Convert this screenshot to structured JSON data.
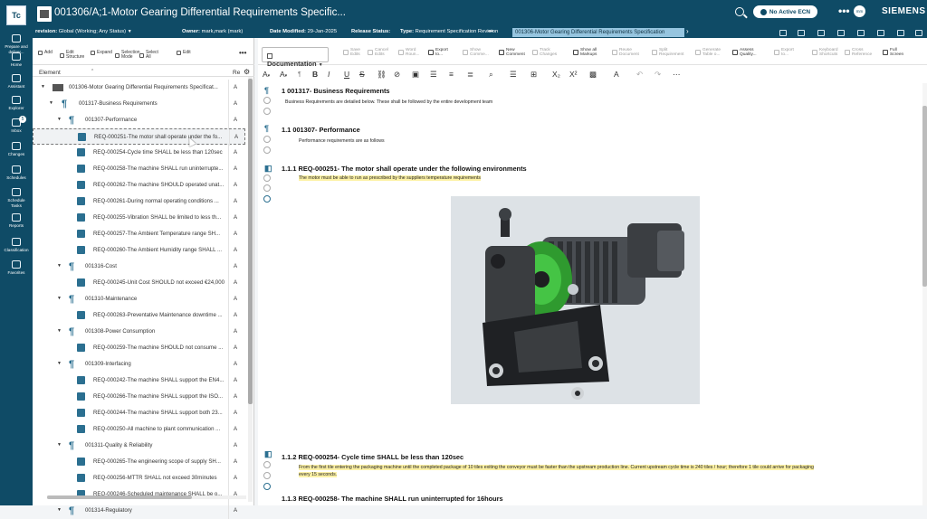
{
  "nav": {
    "logo": "Tc",
    "items": [
      {
        "label_1": "Prepare and",
        "label_2": "deliver..."
      },
      {
        "label_1": "Home",
        "label_2": ""
      },
      {
        "label_1": "Assistant",
        "label_2": ""
      },
      {
        "label_1": "Explorer",
        "label_2": ""
      },
      {
        "label_1": "Inbox",
        "label_2": ""
      },
      {
        "label_1": "Changes",
        "label_2": ""
      },
      {
        "label_1": "Schedules",
        "label_2": ""
      },
      {
        "label_1": "Schedule",
        "label_2": "Tasks"
      },
      {
        "label_1": "Reports",
        "label_2": ""
      },
      {
        "label_1": "Classification",
        "label_2": ""
      },
      {
        "label_1": "Favorites",
        "label_2": ""
      }
    ],
    "inbox_badge": "5"
  },
  "header": {
    "title": "001306/A;1-Motor Gearing Differential Requirements Specific...",
    "ecn": "No Active ECN",
    "avatar": "mm",
    "brand": "SIEMENS",
    "more": "•••"
  },
  "info": {
    "revision_label": "revision:",
    "revision_value": "Global (Working; Any Status)",
    "owner_label": "Owner:",
    "owner_value": "mark,mark (mark)",
    "date_label": "Date Modified:",
    "date_value": "29-Jan-2025",
    "release_label": "Release Status:",
    "type_label": "Type:",
    "type_value": "Requirement Specification Revision",
    "more": "•••",
    "tag": "001306-Motor Gearing Differential Requirements Specification",
    "chevron": "›"
  },
  "left_toolbar": [
    {
      "l1": "Add",
      "l2": ""
    },
    {
      "l1": "Edit",
      "l2": "Structure"
    },
    {
      "l1": "Expand",
      "l2": ""
    },
    {
      "l1": "Selection",
      "l2": "Mode"
    },
    {
      "l1": "Select",
      "l2": "All"
    },
    {
      "l1": "Edit",
      "l2": ""
    }
  ],
  "left_more": "•••",
  "tree_header": {
    "element": "Element",
    "rev": "Re"
  },
  "tree": [
    {
      "label": "001306-Motor Gearing Differential Requirements Specificat...",
      "rev": "A",
      "level": 0,
      "icon": "root",
      "toggle": "▼"
    },
    {
      "label": "001317-Business Requirements",
      "rev": "A",
      "level": 1,
      "icon": "para",
      "toggle": "▼"
    },
    {
      "label": "001307-Performance",
      "rev": "A",
      "level": 2,
      "icon": "para",
      "toggle": "▼"
    },
    {
      "label": "REQ-000251-The motor shall operate under the fo...",
      "rev": "A",
      "level": 3,
      "icon": "req",
      "toggle": "",
      "selected": true
    },
    {
      "label": "REQ-000254-Cycle time SHALL be less than 120sec",
      "rev": "A",
      "level": 3,
      "icon": "req",
      "toggle": ""
    },
    {
      "label": "REQ-000258-The machine SHALL run uninterrupte...",
      "rev": "A",
      "level": 3,
      "icon": "req",
      "toggle": ""
    },
    {
      "label": "REQ-000262-The machine SHOULD operated unat...",
      "rev": "A",
      "level": 3,
      "icon": "req",
      "toggle": ""
    },
    {
      "label": "REQ-000261-During normal operating conditions ...",
      "rev": "A",
      "level": 3,
      "icon": "req",
      "toggle": ""
    },
    {
      "label": "REQ-000255-Vibration SHALL be limited to less th...",
      "rev": "A",
      "level": 3,
      "icon": "req",
      "toggle": ""
    },
    {
      "label": "REQ-000257-The Ambient Temperature range SH...",
      "rev": "A",
      "level": 3,
      "icon": "req",
      "toggle": ""
    },
    {
      "label": "REQ-000260-The Ambient Humidity range SHALL ...",
      "rev": "A",
      "level": 3,
      "icon": "req",
      "toggle": ""
    },
    {
      "label": "001316-Cost",
      "rev": "A",
      "level": 2,
      "icon": "para",
      "toggle": "▼"
    },
    {
      "label": "REQ-000245-Unit Cost SHOULD not exceed €24,000",
      "rev": "A",
      "level": 3,
      "icon": "req",
      "toggle": ""
    },
    {
      "label": "001310-Maintenance",
      "rev": "A",
      "level": 2,
      "icon": "para",
      "toggle": "▼"
    },
    {
      "label": "REQ-000263-Preventative Maintenance downtime ...",
      "rev": "A",
      "level": 3,
      "icon": "req",
      "toggle": ""
    },
    {
      "label": "001308-Power Consumption",
      "rev": "A",
      "level": 2,
      "icon": "para",
      "toggle": "▼"
    },
    {
      "label": "REQ-000259-The machine SHOULD not consume ...",
      "rev": "A",
      "level": 3,
      "icon": "req",
      "toggle": ""
    },
    {
      "label": "001309-Interfacing",
      "rev": "A",
      "level": 2,
      "icon": "para",
      "toggle": "▼"
    },
    {
      "label": "REQ-000242-The machine SHALL support the EN4...",
      "rev": "A",
      "level": 3,
      "icon": "req",
      "toggle": ""
    },
    {
      "label": "REQ-000266-The machine SHALL support the ISO...",
      "rev": "A",
      "level": 3,
      "icon": "req",
      "toggle": ""
    },
    {
      "label": "REQ-000244-The machine SHALL support both 23...",
      "rev": "A",
      "level": 3,
      "icon": "req",
      "toggle": ""
    },
    {
      "label": "REQ-000250-All machine to plant communication ...",
      "rev": "A",
      "level": 3,
      "icon": "req",
      "toggle": ""
    },
    {
      "label": "001311-Quality & Reliability",
      "rev": "A",
      "level": 2,
      "icon": "para",
      "toggle": "▼"
    },
    {
      "label": "REQ-000265-The engineering scope of supply SH...",
      "rev": "A",
      "level": 3,
      "icon": "req",
      "toggle": ""
    },
    {
      "label": "REQ-000256-MTTR SHALL not exceed 30minutes",
      "rev": "A",
      "level": 3,
      "icon": "req",
      "toggle": ""
    },
    {
      "label": "REQ-000246-Scheduled maintenance SHALL be o...",
      "rev": "A",
      "level": 3,
      "icon": "req",
      "toggle": ""
    },
    {
      "label": "001314-Regulatory",
      "rev": "A",
      "level": 2,
      "icon": "para",
      "toggle": "▼"
    }
  ],
  "right_toolbar": {
    "documentation": "Documentation",
    "items": [
      {
        "l1": "Save",
        "l2": "Edits",
        "on": false
      },
      {
        "l1": "Cancel",
        "l2": "Edits",
        "on": false
      },
      {
        "l1": "Word",
        "l2": "Roun...",
        "on": false
      },
      {
        "l1": "Export",
        "l2": "to...",
        "on": true
      },
      {
        "l1": "Show",
        "l2": "Comme...",
        "on": false
      },
      {
        "l1": "New",
        "l2": "Comment",
        "on": true
      },
      {
        "l1": "Track",
        "l2": "Changes",
        "on": false
      },
      {
        "l1": "Show all",
        "l2": "Markups",
        "on": true
      },
      {
        "l1": "Reuse",
        "l2": "Document",
        "on": false
      },
      {
        "l1": "Split",
        "l2": "Requirement",
        "on": false
      },
      {
        "l1": "Generate",
        "l2": "Table o...",
        "on": false
      },
      {
        "l1": "Assess",
        "l2": "Quality...",
        "on": true
      },
      {
        "l1": "Export",
        "l2": "to...",
        "on": false
      },
      {
        "l1": "Keyboard",
        "l2": "Shortcuts",
        "on": false
      },
      {
        "l1": "Cross",
        "l2": "Reference",
        "on": false
      },
      {
        "l1": "Full",
        "l2": "Screen",
        "on": true
      }
    ]
  },
  "format_toolbar": {
    "font_a": "A",
    "font_a2": "A",
    "bold": "B",
    "italic": "I",
    "underline": "U",
    "strike": "S",
    "sub": "X₂",
    "sup": "X²"
  },
  "doc": {
    "h_business": "1 001317- Business Requirements",
    "p_business": "Business Requirements are detailed below. These shall be followed by the entire development team",
    "h_performance": "1.1 001307- Performance",
    "p_performance": "Performance requirements are as follows",
    "h_req251": "1.1.1 REQ-000251- The motor shall operate under the following environments",
    "p_req251": "The motor must be able to run as prescribed by the suppliers temperature requirements",
    "h_req254": "1.1.2 REQ-000254- Cycle time SHALL be less than 120sec",
    "p_req254_1": "From the first tile entering the packaging machine until the completed package of 10 tiles exiting the conveyor must be faster than the upstream production line. Current upstream cycle time is 240 tiles / hour; therefore 1 tile could arrive for packaging",
    "p_req254_2": "every 15 seconds.",
    "h_req258": "1.1.3 REQ-000258- The machine SHALL run uninterrupted for 16hours"
  },
  "colors": {
    "header_bg": "#0f4b66",
    "accent": "#2b6f90",
    "highlight": "#fdf2a6",
    "green_part": "#34b233"
  }
}
